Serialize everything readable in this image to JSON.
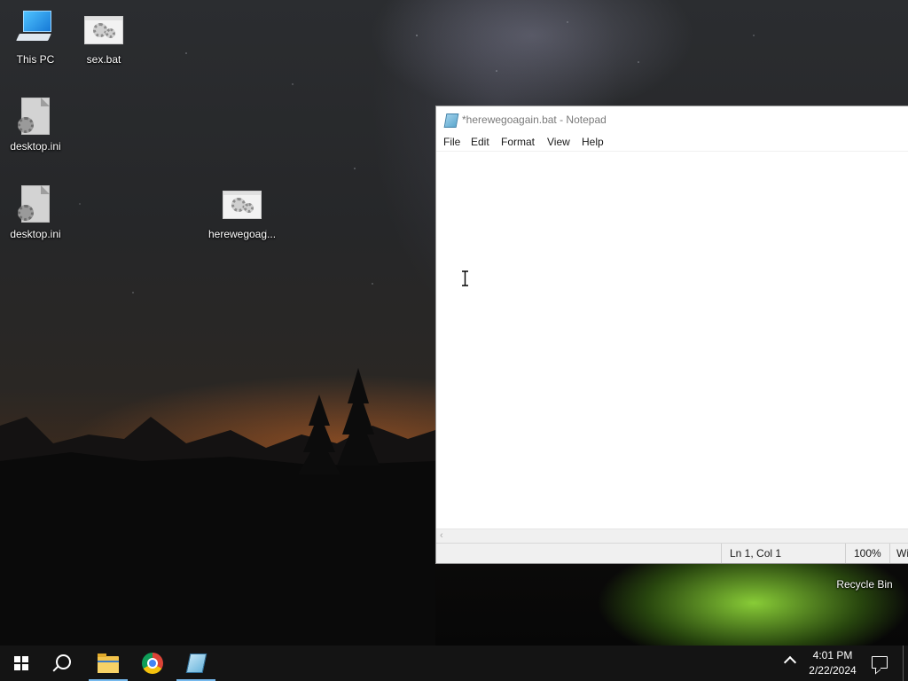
{
  "desktop": {
    "icons": [
      {
        "label": "This PC",
        "icon": "computer-icon"
      },
      {
        "label": "sex.bat",
        "icon": "batch-file-icon"
      },
      {
        "label": "desktop.ini",
        "icon": "settings-file-icon"
      },
      {
        "label": "desktop.ini",
        "icon": "settings-file-icon"
      },
      {
        "label": "herewegoag...",
        "icon": "batch-file-icon"
      },
      {
        "label": "Recycle Bin",
        "icon": "recycle-bin-icon"
      }
    ]
  },
  "notepad": {
    "title": "*herewegoagain.bat - Notepad",
    "menu": [
      "File",
      "Edit",
      "Format",
      "View",
      "Help"
    ],
    "content": "",
    "status": {
      "position": "Ln 1, Col 1",
      "zoom": "100%",
      "line_ending": "Wi"
    }
  },
  "taskbar": {
    "items": [
      "start-icon",
      "search-icon",
      "file-explorer-icon",
      "chrome-icon",
      "notepad-icon"
    ],
    "active": "notepad-icon",
    "time": "4:01 PM",
    "date": "2/22/2024"
  },
  "colors": {
    "taskbar": "#141414",
    "accent": "#76b9ed",
    "tent_glow": "#96e13c"
  }
}
